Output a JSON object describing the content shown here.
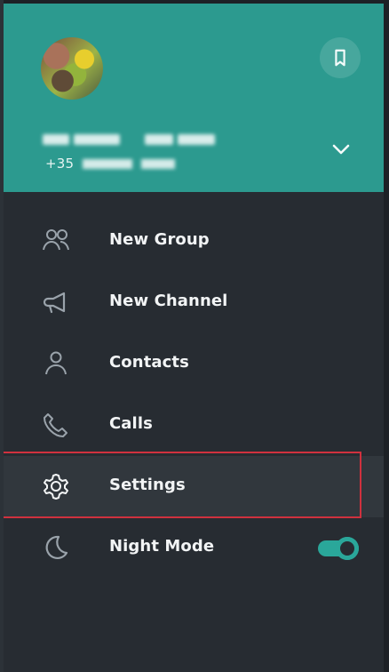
{
  "header": {
    "phone_prefix": "+35"
  },
  "menu": {
    "items": [
      {
        "label": "New Group"
      },
      {
        "label": "New Channel"
      },
      {
        "label": "Contacts"
      },
      {
        "label": "Calls"
      },
      {
        "label": "Settings"
      },
      {
        "label": "Night Mode"
      }
    ],
    "night_mode_enabled": true
  },
  "icons": {
    "bookmark": "bookmark-icon",
    "expand": "chevron-down-icon",
    "new_group": "group-icon",
    "new_channel": "megaphone-icon",
    "contacts": "person-icon",
    "calls": "phone-icon",
    "settings": "gear-icon",
    "night_mode": "moon-icon"
  },
  "colors": {
    "header": "#2c9a8f",
    "panel": "#272c32",
    "accent": "#2aa79a",
    "highlight_border": "#d0313e",
    "text": "#f2f4f5"
  }
}
